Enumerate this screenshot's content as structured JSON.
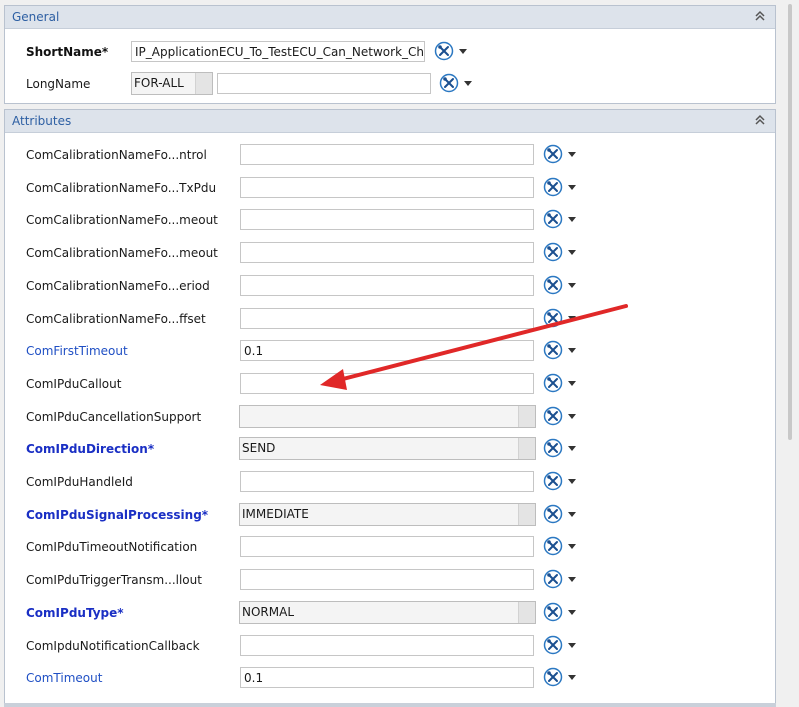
{
  "general": {
    "title": "General",
    "shortname_label": "ShortName*",
    "shortname_value": "IP_ApplicationECU_To_TestECU_Can_Network_Char",
    "longname_label": "LongName",
    "longname_lang": "FOR-ALL",
    "longname_value": ""
  },
  "attributes": {
    "title": "Attributes",
    "rows": [
      {
        "label": "ComCalibrationNameFo...ntrol",
        "value": "",
        "kind": "field",
        "style": "plain"
      },
      {
        "label": "ComCalibrationNameFo...TxPdu",
        "value": "",
        "kind": "field",
        "style": "plain"
      },
      {
        "label": "ComCalibrationNameFo...meout",
        "value": "",
        "kind": "field",
        "style": "plain"
      },
      {
        "label": "ComCalibrationNameFo...meout",
        "value": "",
        "kind": "field",
        "style": "plain"
      },
      {
        "label": "ComCalibrationNameFo...eriod",
        "value": "",
        "kind": "field",
        "style": "plain"
      },
      {
        "label": "ComCalibrationNameFo...ffset",
        "value": "",
        "kind": "field",
        "style": "plain"
      },
      {
        "label": "ComFirstTimeout",
        "value": "0.1",
        "kind": "field",
        "style": "link"
      },
      {
        "label": "ComIPduCallout",
        "value": "",
        "kind": "field",
        "style": "plain"
      },
      {
        "label": "ComIPduCancellationSupport",
        "value": "",
        "kind": "combo",
        "style": "plain"
      },
      {
        "label": "ComIPduDirection*",
        "value": "SEND",
        "kind": "combo",
        "style": "req"
      },
      {
        "label": "ComIPduHandleId",
        "value": "",
        "kind": "field",
        "style": "plain"
      },
      {
        "label": "ComIPduSignalProcessing*",
        "value": "IMMEDIATE",
        "kind": "combo",
        "style": "req"
      },
      {
        "label": "ComIPduTimeoutNotification",
        "value": "",
        "kind": "field",
        "style": "plain"
      },
      {
        "label": "ComIPduTriggerTransm...llout",
        "value": "",
        "kind": "field",
        "style": "plain"
      },
      {
        "label": "ComIPduType*",
        "value": "NORMAL",
        "kind": "combo",
        "style": "req"
      },
      {
        "label": "ComIpduNotificationCallback",
        "value": "",
        "kind": "field",
        "style": "plain"
      },
      {
        "label": "ComTimeout",
        "value": "0.1",
        "kind": "field",
        "style": "link"
      }
    ]
  },
  "colors": {
    "header_bg": "#dde3eb",
    "header_text": "#2d5fa3",
    "required_label": "#1a2fc4",
    "link_label": "#1f4fc4",
    "annotation_arrow": "#e02828"
  },
  "icons": {
    "tool": "wrench-tools-icon",
    "menu": "dropdown-arrow-icon",
    "collapse": "double-chevron-up-icon"
  }
}
